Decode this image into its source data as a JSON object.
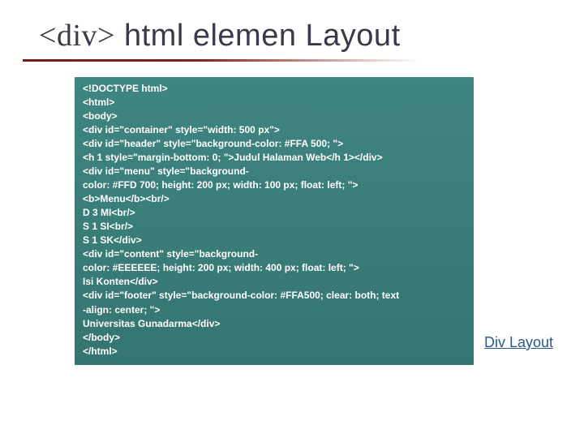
{
  "title_prefix_lt": "<",
  "title_tag": "div",
  "title_prefix_gt": ">",
  "title_text": " html elemen Layout",
  "code": "<!DOCTYPE html>\n<html>\n<body>\n<div id=\"container\" style=\"width: 500 px\">\n<div id=\"header\" style=\"background-color: #FFA 500; \">\n<h 1 style=\"margin-bottom: 0; \">Judul Halaman Web</h 1></div>\n<div id=\"menu\" style=\"background-\ncolor: #FFD 700; height: 200 px; width: 100 px; float: left; \">\n<b>Menu</b><br/>\nD 3 MI<br/>\nS 1 SI<br/>\nS 1 SK</div>\n<div id=\"content\" style=\"background-\ncolor: #EEEEEE; height: 200 px; width: 400 px; float: left; \">\nIsi Konten</div>\n<div id=\"footer\" style=\"background-color: #FFA500; clear: both; text\n-align: center; \">\nUniversitas Gunadarma</div>\n</body>\n</html>",
  "link_text": "Div Layout"
}
